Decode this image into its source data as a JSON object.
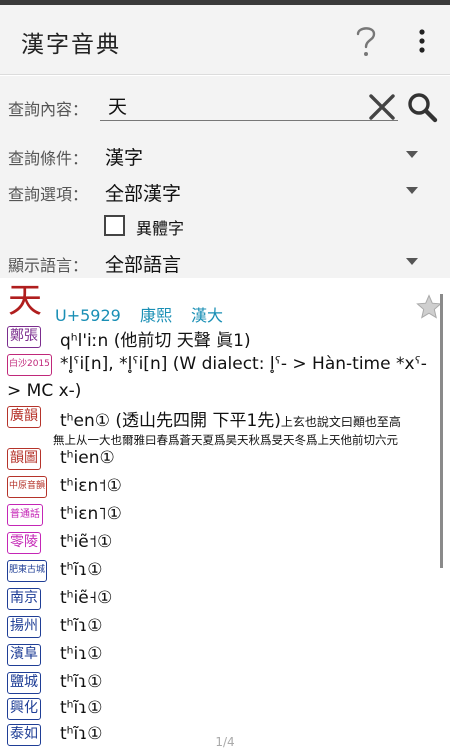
{
  "app": {
    "title": "漢字音典"
  },
  "icons": {
    "help": "help-icon",
    "more": "more-vert-icon",
    "clear": "close-icon",
    "search": "search-icon",
    "star": "star-icon"
  },
  "form": {
    "query_label": "查詢內容：",
    "query_value": "天",
    "condition_label": "查詢條件：",
    "condition_value": "漢字",
    "option_label": "查詢選項：",
    "option_value": "全部漢字",
    "variant_label": "異體字",
    "variant_checked": false,
    "language_label": "顯示語言：",
    "language_value": "全部語言"
  },
  "entry": {
    "char": "天",
    "codepoint": "U+5929",
    "kangxi": "康熙",
    "handa": "漢大",
    "readings": [
      {
        "tag": "鄭張",
        "color": "#7b2d8e",
        "text": "qʰl'iːn (他前切 天聲 眞1)"
      },
      {
        "tag": "白沙2015",
        "color": "#c0287a",
        "text": "*l̥ˤi[n], *l̥ˤi[n] (W dialect: l̥ˤ- > Hàn-time *xˤ-",
        "cont": "> MC x-)"
      },
      {
        "tag": "廣韻",
        "color": "#b5332a",
        "text": "tʰen① (透山先四開 下平1先)",
        "note": "上玄也說文曰顚也至高",
        "cont": "無上从一大也爾雅曰春爲蒼天夏爲昊天秋爲旻天冬爲上天他前切六元"
      },
      {
        "tag": "韻圖",
        "color": "#b5332a",
        "text": "tʰien①"
      },
      {
        "tag": "中原音韻",
        "color": "#b5332a",
        "text": "tʰiɛn˦①"
      },
      {
        "tag": "普通話",
        "color": "#c426b6",
        "text": "tʰiɛn˥①"
      },
      {
        "tag": "零陵",
        "color": "#c426b6",
        "text": "tʰiẽ˦①"
      },
      {
        "tag": "肥東古城",
        "color": "#1f3e96",
        "text": "tʰĩɿ①"
      },
      {
        "tag": "南京",
        "color": "#1f3e96",
        "text": "tʰiẽ˧①"
      },
      {
        "tag": "揚州",
        "color": "#1f3e96",
        "text": "tʰĩɿ①"
      },
      {
        "tag": "濱阜",
        "color": "#1f3e96",
        "text": "tʰiɿ①"
      },
      {
        "tag": "鹽城",
        "color": "#1f3e96",
        "text": "tʰĩɿ①"
      },
      {
        "tag": "興化",
        "color": "#1f3e96",
        "text": "tʰĩɿ①"
      },
      {
        "tag": "泰如",
        "color": "#1f3e96",
        "text": "tʰĩɿ①"
      }
    ]
  },
  "pager": "1/4"
}
